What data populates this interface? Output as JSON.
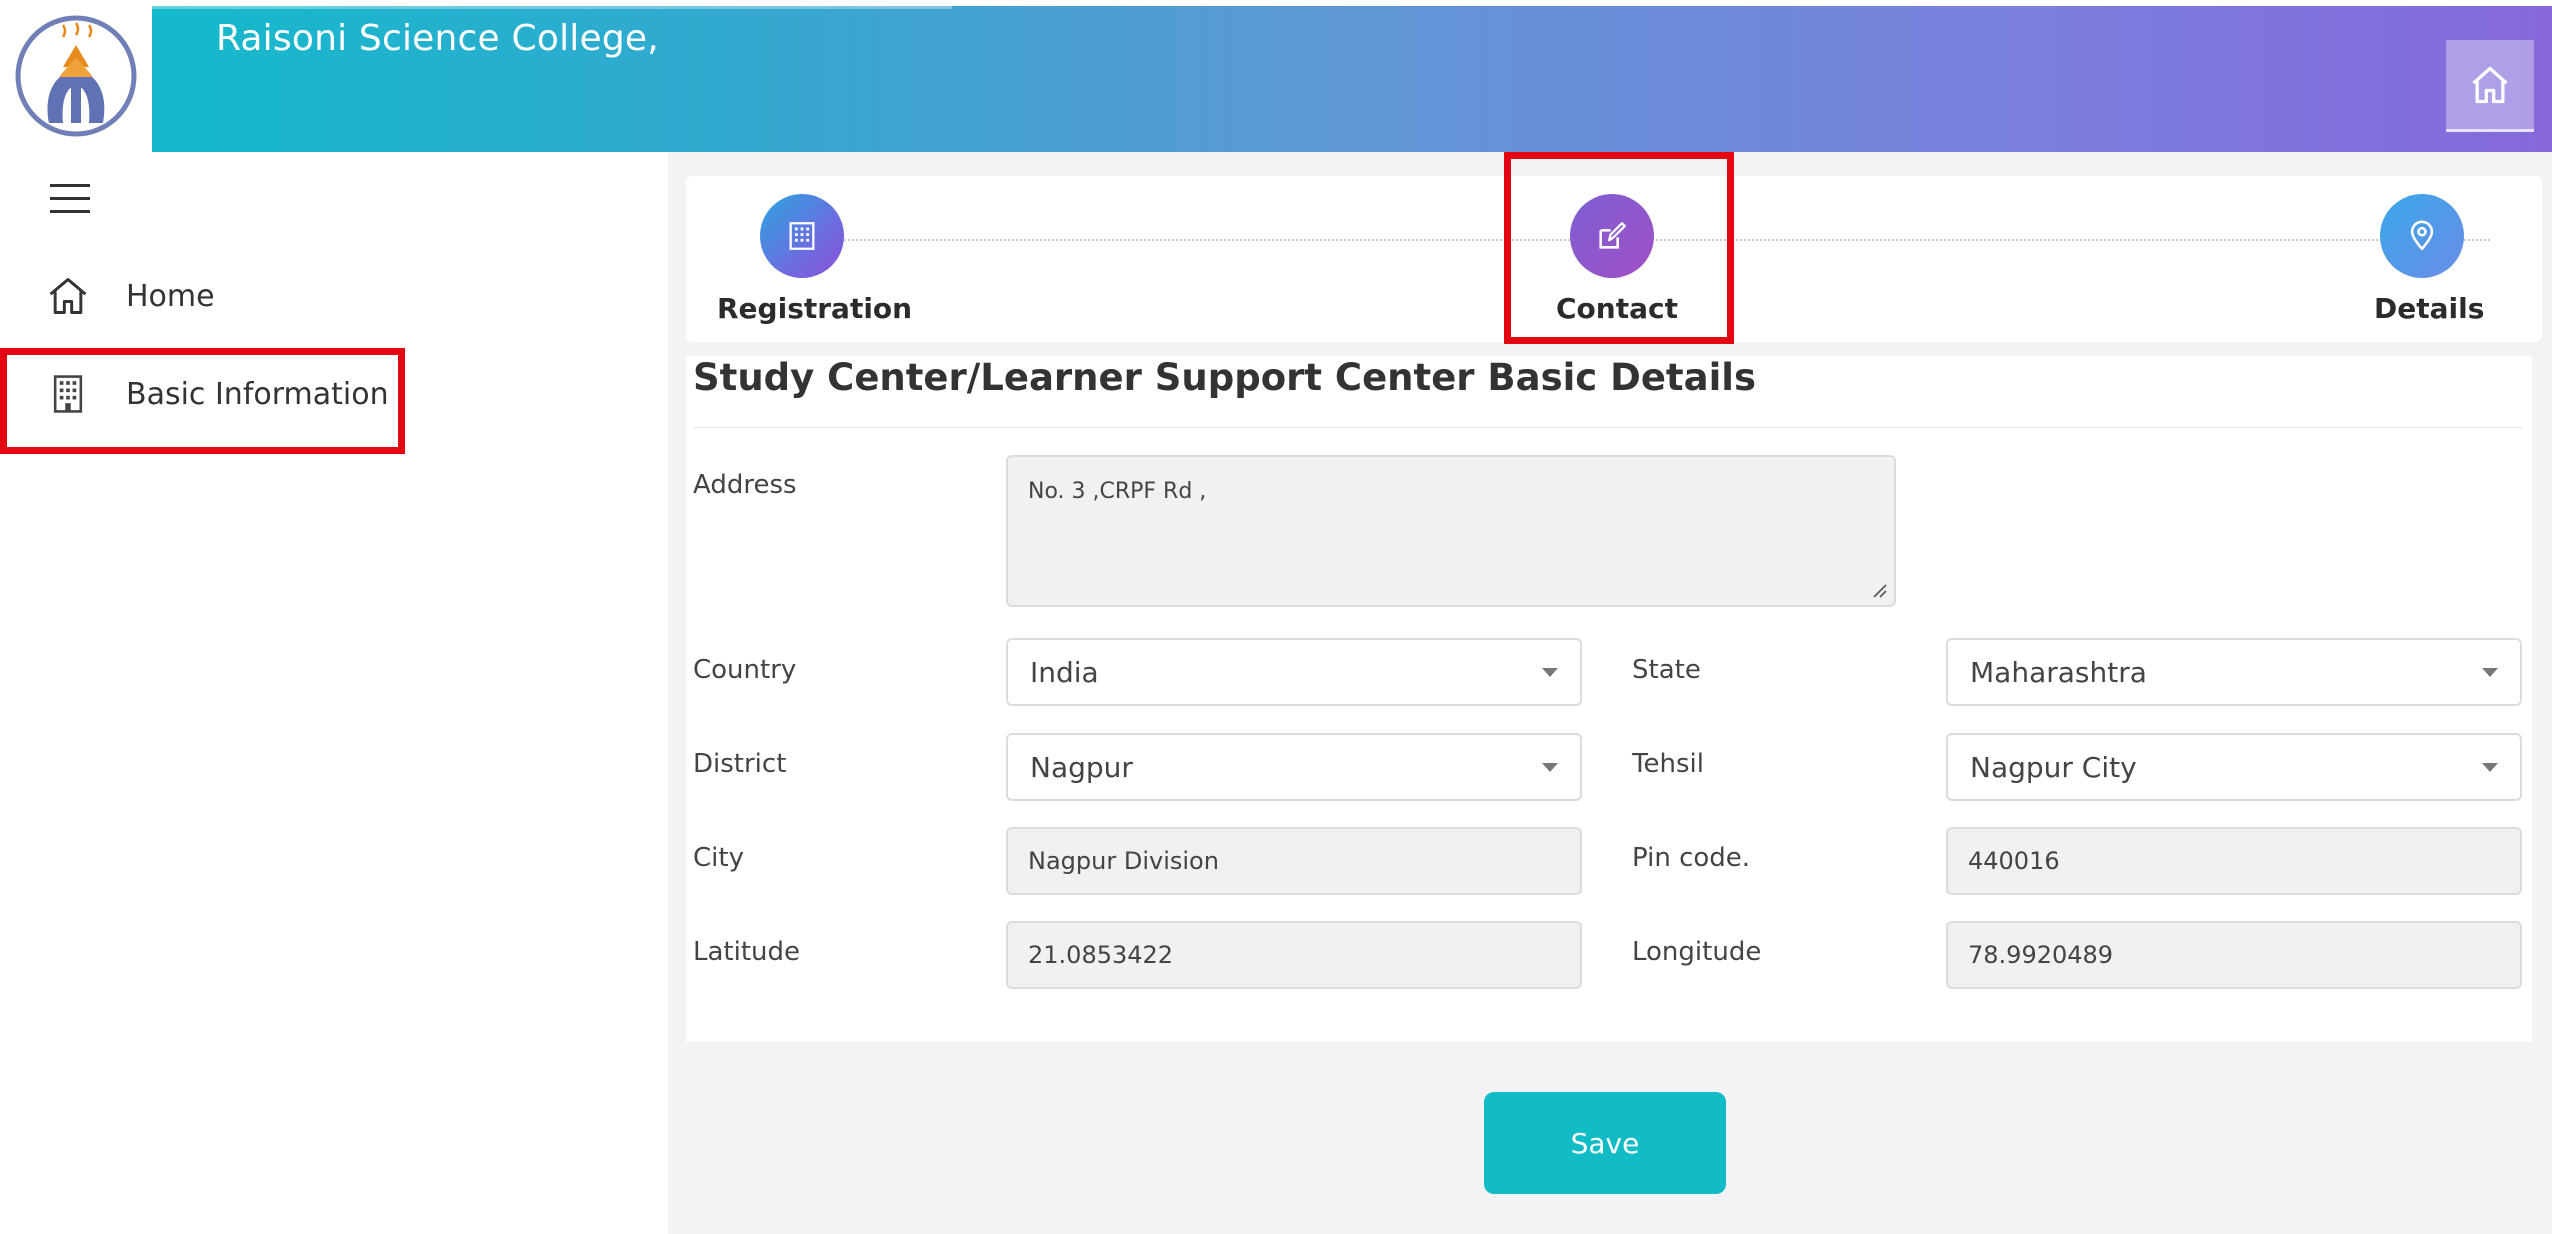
{
  "header": {
    "college_name": "Raisoni Science College,"
  },
  "sidebar": {
    "items": [
      {
        "label": "Home",
        "icon": "home-icon"
      },
      {
        "label": "Basic Information",
        "icon": "building-icon"
      }
    ]
  },
  "stepper": {
    "steps": [
      {
        "label": "Registration",
        "icon": "building-icon"
      },
      {
        "label": "Contact",
        "icon": "edit-icon"
      },
      {
        "label": "Details",
        "icon": "location-pin-icon"
      }
    ]
  },
  "form": {
    "title": "Study Center/Learner Support Center Basic Details",
    "address": {
      "label": "Address",
      "value": "No. 3 ,CRPF Rd ,"
    },
    "country": {
      "label": "Country",
      "value": "India"
    },
    "state": {
      "label": "State",
      "value": "Maharashtra"
    },
    "district": {
      "label": "District",
      "value": "Nagpur"
    },
    "tehsil": {
      "label": "Tehsil",
      "value": "Nagpur City"
    },
    "city": {
      "label": "City",
      "value": "Nagpur Division"
    },
    "pincode": {
      "label": "Pin code.",
      "value": "440016"
    },
    "latitude": {
      "label": "Latitude",
      "value": "21.0853422"
    },
    "longitude": {
      "label": "Longitude",
      "value": "78.9920489"
    }
  },
  "actions": {
    "save_label": "Save"
  },
  "colors": {
    "header_start": "#14b9cc",
    "header_end": "#8668dc",
    "save_button": "#12bcc6",
    "highlight": "#e30613"
  }
}
